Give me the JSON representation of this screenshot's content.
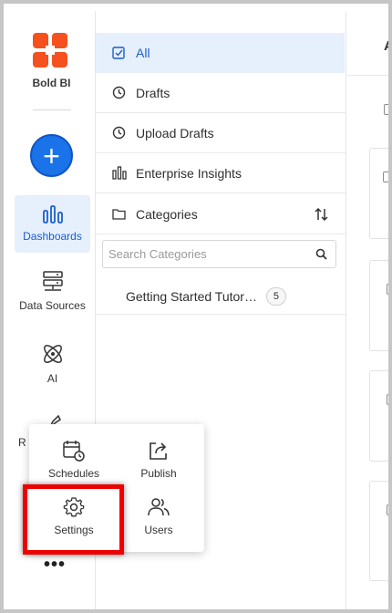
{
  "brand": {
    "name": "Bold BI",
    "colors": {
      "orange": "#f5511e",
      "accent": "#1a73e8",
      "highlight": "#ee0000"
    }
  },
  "rail": {
    "create_label": "+",
    "items": [
      {
        "label": "Dashboards",
        "icon": "bar-chart-icon",
        "active": true
      },
      {
        "label": "Data Sources",
        "icon": "server-icon",
        "active": false
      },
      {
        "label": "AI",
        "icon": "atom-icon",
        "active": false
      },
      {
        "label": "R",
        "icon": "pin-icon",
        "active": false
      }
    ],
    "more_label": "•••"
  },
  "panel": {
    "items": [
      {
        "label": "All",
        "icon": "checkbox-icon"
      },
      {
        "label": "Drafts",
        "icon": "clock-icon"
      },
      {
        "label": "Upload Drafts",
        "icon": "clock-icon"
      },
      {
        "label": "Enterprise Insights",
        "icon": "bar-chart-icon"
      },
      {
        "label": "Categories",
        "icon": "folder-icon"
      }
    ],
    "search_placeholder": "Search Categories",
    "categories": [
      {
        "label": "Getting Started Tutor…",
        "count": "5"
      }
    ]
  },
  "content": {
    "header_letter": "A"
  },
  "popup": {
    "items": [
      {
        "label": "Schedules",
        "icon": "calendar-clock-icon"
      },
      {
        "label": "Publish",
        "icon": "share-icon"
      },
      {
        "label": "Settings",
        "icon": "gear-icon"
      },
      {
        "label": "Users",
        "icon": "users-icon"
      }
    ]
  }
}
